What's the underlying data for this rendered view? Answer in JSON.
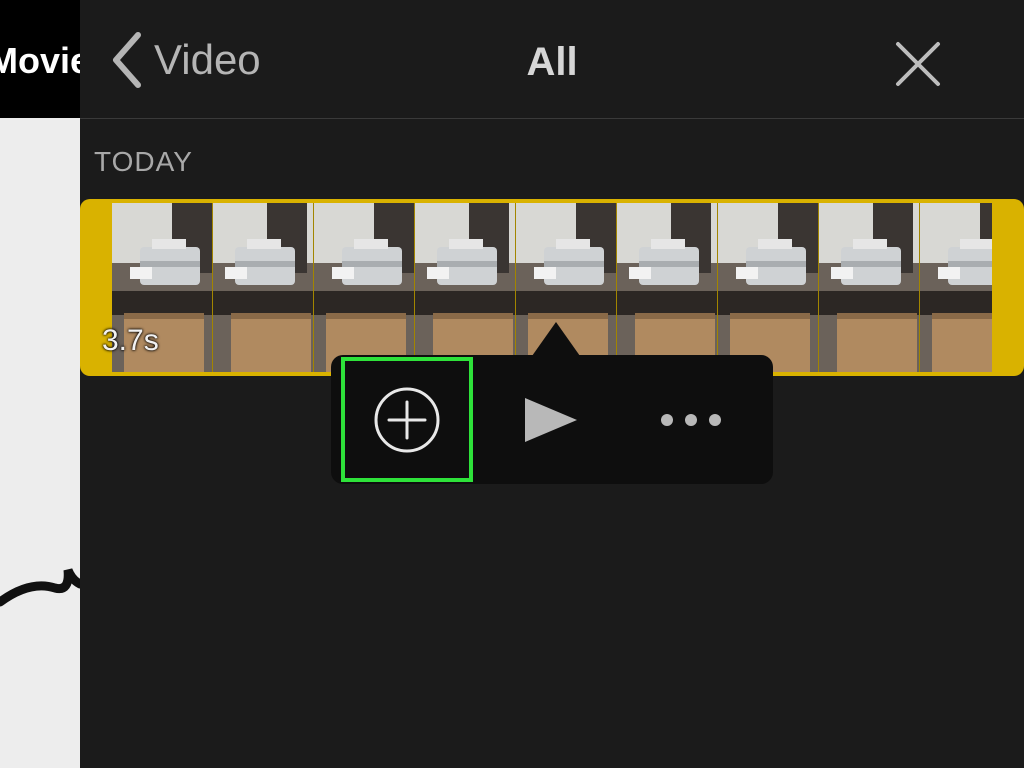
{
  "background_app": {
    "title": "Movie"
  },
  "topbar": {
    "back_label": "Video",
    "title": "All",
    "back_icon": "chevron-left-icon",
    "close_icon": "close-icon"
  },
  "section": {
    "label": "TODAY"
  },
  "clip": {
    "duration": "3.7s",
    "selected_border_color": "#d9b200",
    "frame_count": 9
  },
  "popover": {
    "actions": [
      {
        "name": "add",
        "icon": "plus-circle-icon",
        "highlighted": true
      },
      {
        "name": "play",
        "icon": "play-icon"
      },
      {
        "name": "more",
        "icon": "more-icon"
      }
    ],
    "highlight_color": "#2ee23a"
  }
}
